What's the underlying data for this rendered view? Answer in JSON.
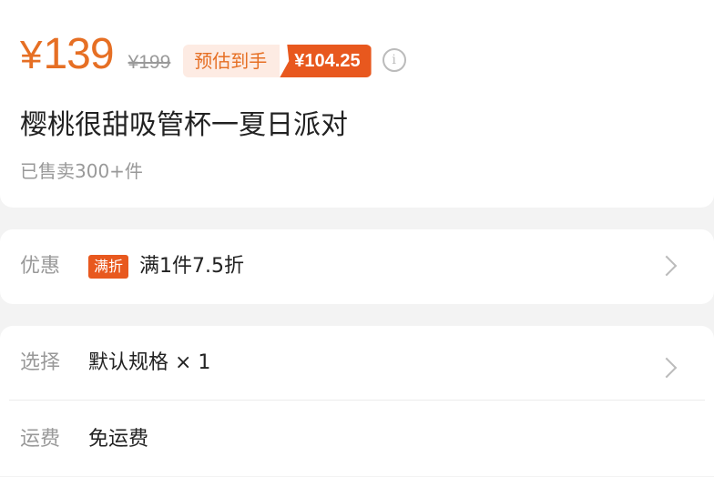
{
  "product": {
    "currency": "¥",
    "price": "139",
    "original_price": "¥199",
    "estimate_label": "预估到手",
    "estimate_value": "¥104.25",
    "title": "樱桃很甜吸管杯一夏日派对",
    "sold": "已售卖300+件"
  },
  "promo": {
    "label": "优惠",
    "badge": "满折",
    "text": "满1件7.5折"
  },
  "spec": {
    "label": "选择",
    "value": "默认规格 × 1"
  },
  "shipping": {
    "label": "运费",
    "value": "免运费"
  },
  "colors": {
    "accent": "#e66f24",
    "badge": "#e8581e"
  }
}
